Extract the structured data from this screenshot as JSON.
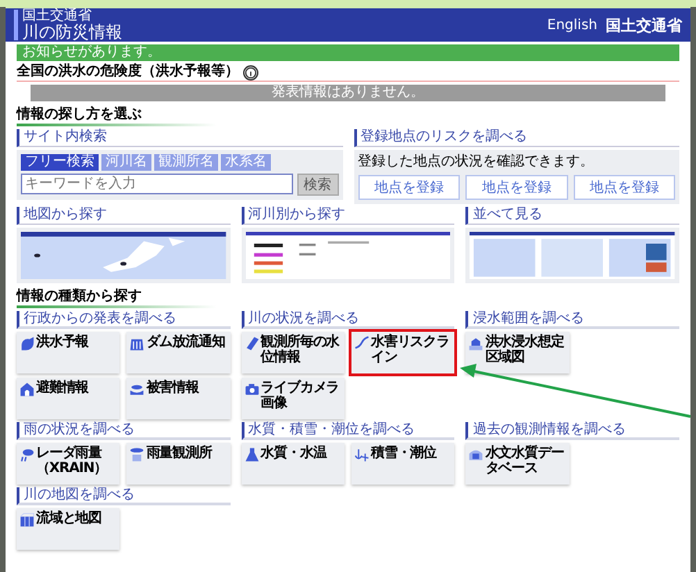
{
  "header": {
    "ministry": "国土交通省",
    "title": "川の防災情報",
    "link": "English",
    "logo_text": "国土交通省"
  },
  "notice": {
    "text": "お知らせがあります。"
  },
  "flood_risk": {
    "title": "全国の洪水の危険度（洪水予報等）",
    "status": "発表情報はありません。"
  },
  "find_by_method": {
    "title": "情報の探し方を選ぶ",
    "search": {
      "title": "サイト内検索",
      "tabs": [
        {
          "label": "フリー検索",
          "selected": true
        },
        {
          "label": "河川名",
          "selected": false
        },
        {
          "label": "観測所名",
          "selected": false
        },
        {
          "label": "水系名",
          "selected": false
        }
      ],
      "placeholder": "キーワードを入力",
      "button": "検索"
    },
    "risk": {
      "title": "登録地点のリスクを調べる",
      "text": "登録した地点の状況を確認できます。",
      "buttons": [
        "地点を登録",
        "地点を登録",
        "地点を登録"
      ]
    },
    "panels": [
      {
        "title": "地図から探す",
        "kind": "map"
      },
      {
        "title": "河川別から探す",
        "kind": "list"
      },
      {
        "title": "並べて見る",
        "kind": "multi"
      }
    ]
  },
  "find_by_type": {
    "title": "情報の種類から探す",
    "groups": [
      {
        "title": "行政からの発表を調べる",
        "cards": [
          {
            "title": "洪水予報",
            "highlighted": false
          },
          {
            "title": "ダム放流通知",
            "highlighted": false
          },
          {
            "title": "避難情報",
            "highlighted": false
          },
          {
            "title": "被害情報",
            "highlighted": false
          }
        ]
      },
      {
        "title": "川の状況を調べる",
        "cards": [
          {
            "title": "観測所毎の水位情報",
            "highlighted": false
          },
          {
            "title": "水害リスクライン",
            "highlighted": true
          },
          {
            "title": "ライブカメラ画像",
            "highlighted": false
          }
        ]
      },
      {
        "title": "浸水範囲を調べる",
        "cards": [
          {
            "title": "洪水浸水想定区域図",
            "highlighted": false
          }
        ]
      },
      {
        "title": "雨の状況を調べる",
        "cards": [
          {
            "title": "レーダ雨量（XRAIN）",
            "highlighted": false
          },
          {
            "title": "雨量観測所",
            "highlighted": false
          }
        ]
      },
      {
        "title": "水質・積雪・潮位を調べる",
        "cards": [
          {
            "title": "水質・水温",
            "highlighted": false
          },
          {
            "title": "積雪・潮位",
            "highlighted": false
          }
        ]
      },
      {
        "title": "過去の観測情報を調べる",
        "cards": [
          {
            "title": "水文水質データベース",
            "highlighted": false
          }
        ]
      },
      {
        "title": "川の地図を調べる",
        "cards": [
          {
            "title": "流域と地図",
            "highlighted": false
          }
        ]
      }
    ]
  }
}
